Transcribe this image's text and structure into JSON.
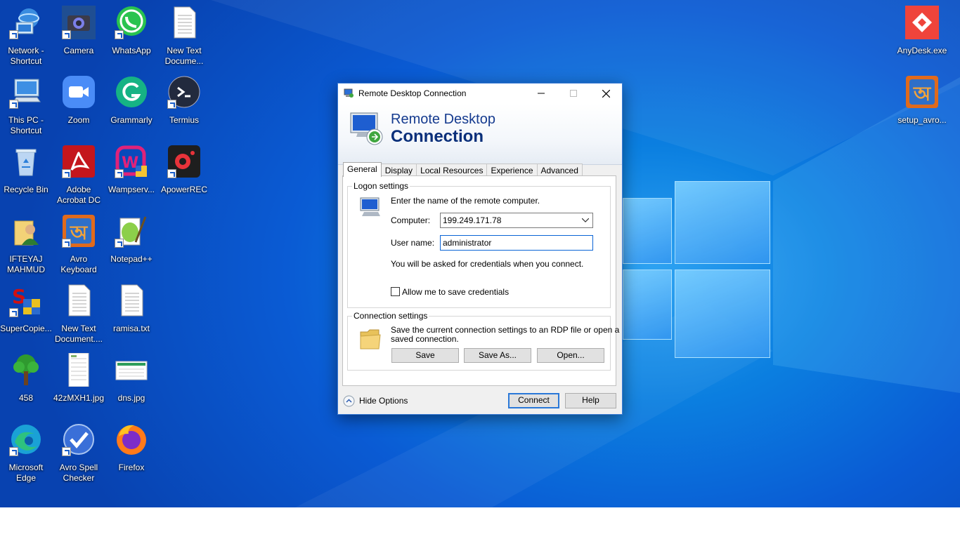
{
  "desktop": {
    "icons": [
      {
        "label": "Network - Shortcut",
        "icon": "network-icon"
      },
      {
        "label": "Camera",
        "icon": "camera-icon"
      },
      {
        "label": "WhatsApp",
        "icon": "whatsapp-icon"
      },
      {
        "label": "New Text Docume...",
        "icon": "text-document-icon"
      },
      {
        "label": "This PC - Shortcut",
        "icon": "this-pc-icon"
      },
      {
        "label": "Zoom",
        "icon": "zoom-icon"
      },
      {
        "label": "Grammarly",
        "icon": "grammarly-icon"
      },
      {
        "label": "Termius",
        "icon": "termius-icon"
      },
      {
        "label": "Recycle Bin",
        "icon": "recycle-bin-icon"
      },
      {
        "label": "Adobe Acrobat DC",
        "icon": "acrobat-icon"
      },
      {
        "label": "Wampserv...",
        "icon": "wampserver-icon"
      },
      {
        "label": "ApowerREC",
        "icon": "apowerrec-icon"
      },
      {
        "label": "IFTEYAJ MAHMUD",
        "icon": "user-folder-icon"
      },
      {
        "label": "Avro Keyboard",
        "icon": "avro-icon"
      },
      {
        "label": "Notepad++",
        "icon": "notepadpp-icon"
      },
      {
        "label": "SuperCopie...",
        "icon": "supercopier-icon"
      },
      {
        "label": "New Text Document....",
        "icon": "text-document-icon"
      },
      {
        "label": "ramisa.txt",
        "icon": "text-document-icon"
      },
      {
        "label": "458",
        "icon": "tree-icon"
      },
      {
        "label": "42zMXH1.jpg",
        "icon": "image-file-icon"
      },
      {
        "label": "dns.jpg",
        "icon": "image-file-icon"
      },
      {
        "label": "Microsoft Edge",
        "icon": "edge-icon"
      },
      {
        "label": "Avro Spell Checker",
        "icon": "spell-checker-icon"
      },
      {
        "label": "Firefox",
        "icon": "firefox-icon"
      },
      {
        "label": "AnyDesk.exe",
        "icon": "anydesk-icon"
      },
      {
        "label": "setup_avro...",
        "icon": "avro-icon"
      }
    ]
  },
  "rdp": {
    "window_title": "Remote Desktop Connection",
    "banner_line1": "Remote Desktop",
    "banner_line2": "Connection",
    "tabs": [
      "General",
      "Display",
      "Local Resources",
      "Experience",
      "Advanced"
    ],
    "logon": {
      "group_label": "Logon settings",
      "instruction": "Enter the name of the remote computer.",
      "computer_label": "Computer:",
      "computer_value": "199.249.171.78",
      "username_label": "User name:",
      "username_value": "administrator",
      "credentials_note": "You will be asked for credentials when you connect.",
      "save_credentials_label": "Allow me to save credentials",
      "save_credentials_checked": false
    },
    "connection": {
      "group_label": "Connection settings",
      "description_line1": "Save the current connection settings to an RDP file or open a",
      "description_line2": "saved connection.",
      "save_button": "Save",
      "save_as_button": "Save As...",
      "open_button": "Open..."
    },
    "footer": {
      "hide_options": "Hide Options",
      "connect_button": "Connect",
      "help_button": "Help"
    }
  }
}
